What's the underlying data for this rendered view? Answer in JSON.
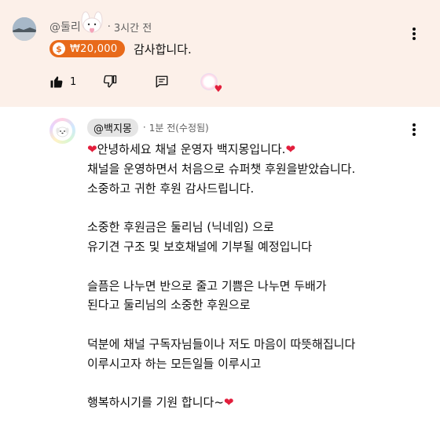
{
  "top_comment": {
    "author": "@둘리",
    "separator": "·",
    "time": "3시간 전",
    "amount": "₩20,000",
    "coin_symbol": "$",
    "text": "감사합니다.",
    "like_count": "1",
    "heart": "♥"
  },
  "reply": {
    "author": "@백지몽",
    "separator": "·",
    "time": "1분 전(수정됨)",
    "heart": "❤",
    "lines": [
      "안녕하세요 채널 운영자 백지몽입니다.",
      "채널을 운영하면서 처음으로 슈퍼챗 후원을받았습니다.",
      "소중하고 귀한 후원 감사드립니다.",
      "",
      "소중한 후원금은 둘리님 (닉네임) 으로",
      "유기견 구조 및 보호채널에 기부될 예정입니다",
      "",
      "슬픔은 나누면 반으로 줄고 기쁨은 나누면 두배가",
      "된다고 둘리님의 소중한 후원으로",
      "",
      "덕분에 채널 구독자님들이나 저도 마음이 따뜻해집니다",
      "이루시고자 하는 모든일들 이루시고",
      "",
      "행복하시기를 기원 합니다~"
    ]
  },
  "colors": {
    "highlight_bg": "#fcf0e9",
    "superchat": "#e86a1a",
    "heart": "#e21e3c",
    "chip_bg": "#e5e5e5"
  }
}
